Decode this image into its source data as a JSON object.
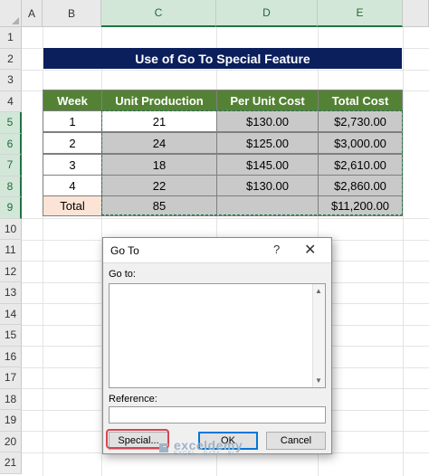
{
  "sheet": {
    "columns": [
      "A",
      "B",
      "C",
      "D",
      "E"
    ],
    "rows": [
      "1",
      "2",
      "3",
      "4",
      "5",
      "6",
      "7",
      "8",
      "9",
      "10",
      "11",
      "12",
      "13",
      "14",
      "15",
      "16",
      "17",
      "18",
      "19",
      "20",
      "21"
    ],
    "title": "Use of Go To Special Feature",
    "table": {
      "headers": [
        "Week",
        "Unit Production",
        "Per Unit Cost",
        "Total Cost"
      ],
      "rows": [
        [
          "1",
          "21",
          "$130.00",
          "$2,730.00"
        ],
        [
          "2",
          "24",
          "$125.00",
          "$3,000.00"
        ],
        [
          "3",
          "18",
          "$145.00",
          "$2,610.00"
        ],
        [
          "4",
          "22",
          "$130.00",
          "$2,860.00"
        ]
      ],
      "total": [
        "Total",
        "85",
        "",
        "$11,200.00"
      ]
    },
    "colors": {
      "title_bg": "#0b1f5c",
      "header_bg": "#548235",
      "selected_fill": "#c9c9c9",
      "total_fill": "#fbe4d5"
    }
  },
  "dialog": {
    "title": "Go To",
    "help": "?",
    "close": "✕",
    "goto_label": "Go to:",
    "reference_label": "Reference:",
    "reference_value": "",
    "special_label": "Special...",
    "ok_label": "OK",
    "cancel_label": "Cancel"
  },
  "watermark": {
    "name": "exceldemy",
    "tagline": "EXCEL · DATA · BI"
  }
}
